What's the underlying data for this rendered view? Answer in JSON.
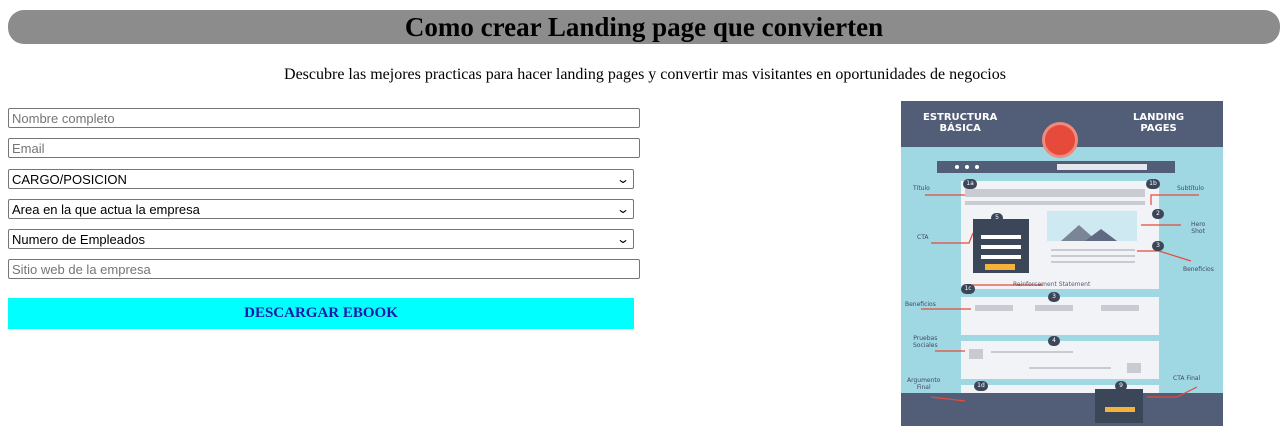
{
  "header": {
    "title": "Como crear Landing page que convierten",
    "subtitle": "Descubre las mejores practicas para hacer landing pages y convertir mas visitantes en oportunidades de negocios"
  },
  "form": {
    "name_placeholder": "Nombre completo",
    "email_placeholder": "Email",
    "cargo_selected": "CARGO/POSICION",
    "area_selected": "Area en la que actua la empresa",
    "empleados_selected": "Numero de Empleados",
    "website_placeholder": "Sitio web de la empresa",
    "submit_label": "DESCARGAR EBOOK"
  },
  "infographic": {
    "header_left_1": "ESTRUCTURA",
    "header_left_2": "BÁSICA",
    "header_right_1": "LANDING",
    "header_right_2": "PAGES",
    "labels": {
      "titulo": "Título",
      "subtitulo": "Subtítulo",
      "hero_1": "Hero",
      "hero_2": "Shot",
      "cta": "CTA",
      "beneficios_right": "Beneficios",
      "reinforcement": "Reinforcement Statement",
      "beneficios_left": "Beneficios",
      "pruebas_1": "Pruebas",
      "pruebas_2": "Sociales",
      "argumento_1": "Argumento",
      "argumento_2": "Final",
      "cta_final": "CTA Final"
    },
    "badges": {
      "b1a": "1a",
      "b1b": "1b",
      "b2": "2",
      "b5": "5",
      "b3a": "3",
      "b1c": "1c",
      "b3b": "3",
      "b4": "4",
      "b1d": "1d",
      "b9": "9"
    }
  },
  "colors": {
    "banner": "#8c8c8c",
    "cta_background": "#00ffff",
    "cta_text": "#1a1aa6",
    "infographic_bg": "#9fd7e3",
    "infographic_dark": "#525d77",
    "accent_red": "#e64a3b"
  }
}
